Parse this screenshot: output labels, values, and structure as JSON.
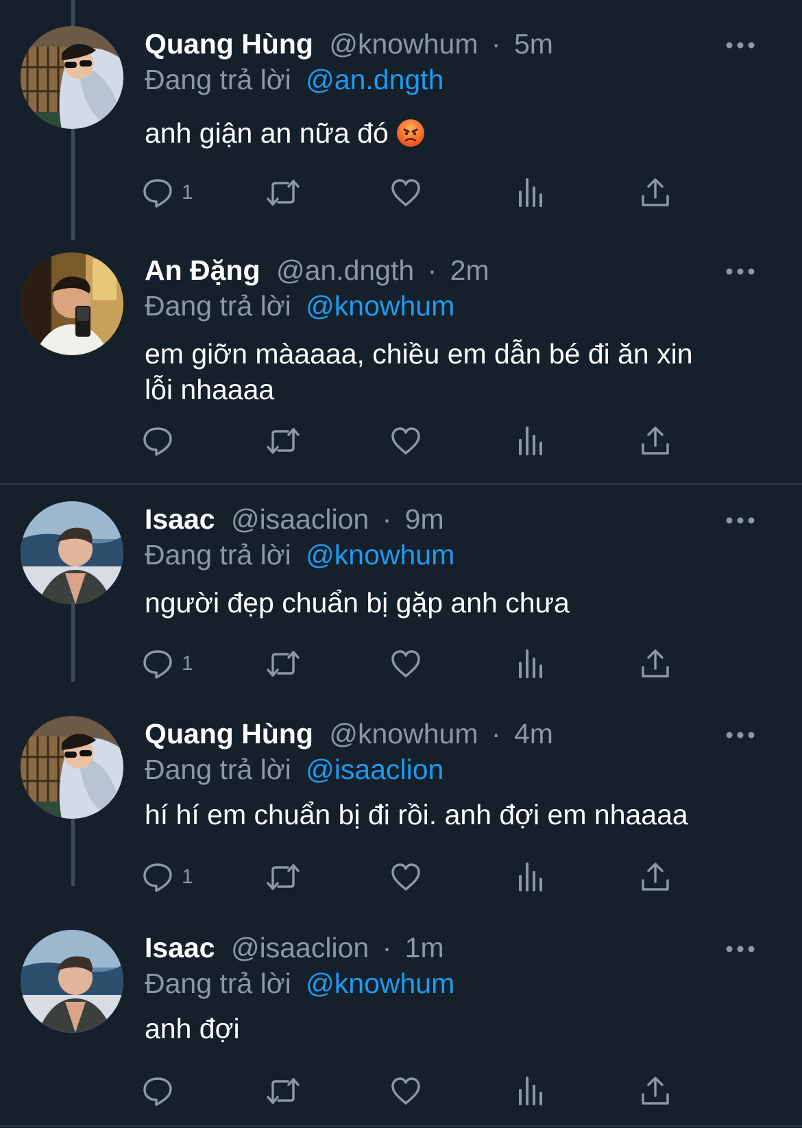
{
  "tweets": [
    {
      "name": "Quang Hùng",
      "handle": "@knowhum",
      "time": "5m",
      "reply_prefix": "Đang trả lời",
      "reply_to": "@an.dngth",
      "text": "anh giận an nữa đó",
      "emoji": "angry-face",
      "reply_count": "1"
    },
    {
      "name": "An Đặng",
      "handle": "@an.dngth",
      "time": "2m",
      "reply_prefix": "Đang trả lời",
      "reply_to": "@knowhum",
      "text_lines": [
        "em giỡn màaaaa, chiều em dẫn bé đi ăn xin",
        "lỗi nhaaaa"
      ],
      "reply_count": ""
    },
    {
      "name": "Isaac",
      "handle": "@isaaclion",
      "time": "9m",
      "reply_prefix": "Đang trả lời",
      "reply_to": "@knowhum",
      "text": "người đẹp chuẩn bị gặp anh chưa",
      "reply_count": "1"
    },
    {
      "name": "Quang Hùng",
      "handle": "@knowhum",
      "time": "4m",
      "reply_prefix": "Đang trả lời",
      "reply_to": "@isaaclion",
      "text": "hí hí em chuẩn bị đi rồi. anh đợi em nhaaaa",
      "reply_count": "1"
    },
    {
      "name": "Isaac",
      "handle": "@isaaclion",
      "time": "1m",
      "reply_prefix": "Đang trả lời",
      "reply_to": "@knowhum",
      "text": "anh đợi",
      "reply_count": ""
    }
  ],
  "separator": "·",
  "colors": {
    "background": "#15202b",
    "secondary_text": "#8b98a5",
    "mention": "#1d9bf0",
    "icon": "#8b98a5"
  },
  "icons": [
    "reply-icon",
    "retweet-icon",
    "like-icon",
    "analytics-icon",
    "share-icon",
    "more-icon"
  ]
}
